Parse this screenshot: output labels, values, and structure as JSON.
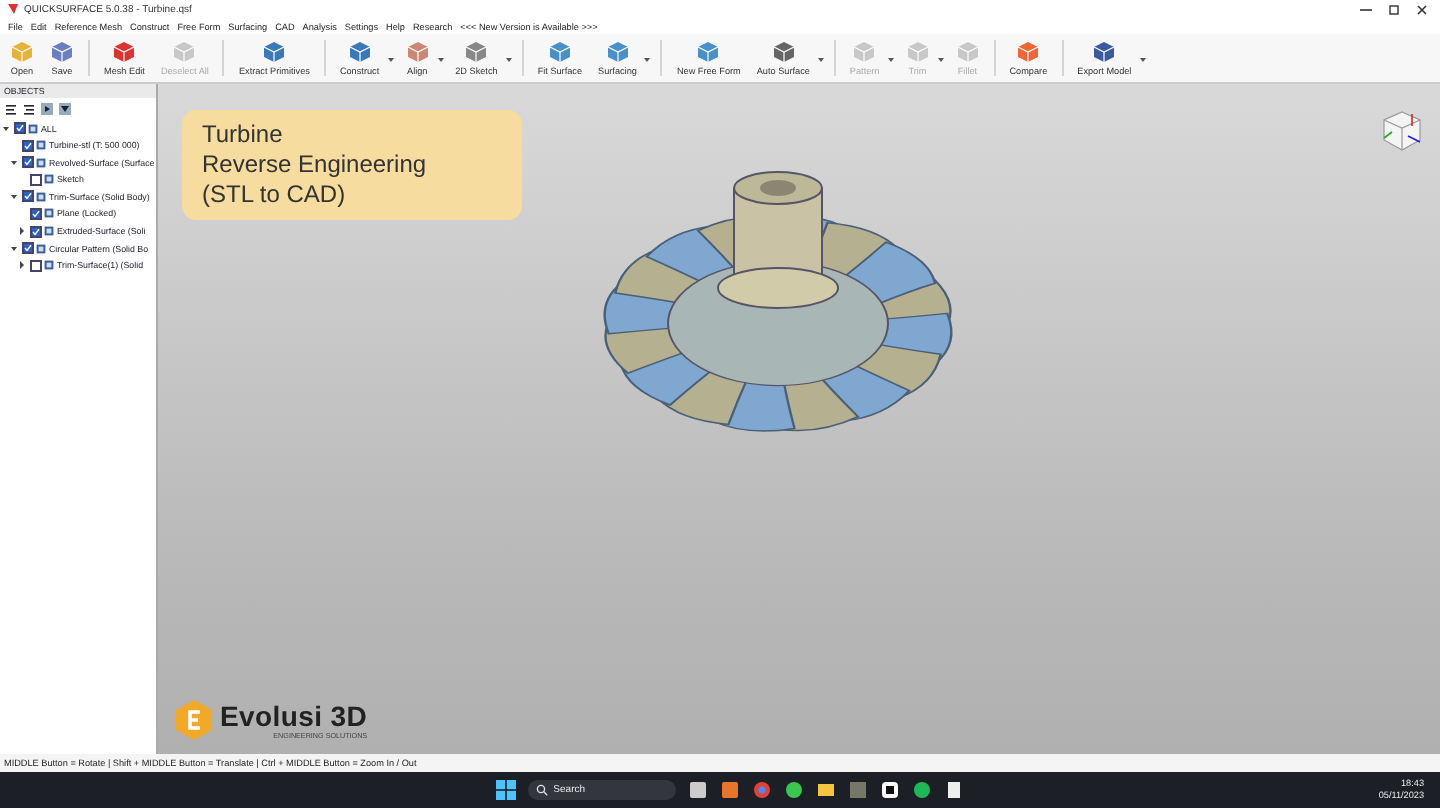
{
  "window": {
    "title": "QUICKSURFACE 5.0.38 - Turbine.qsf"
  },
  "menu": [
    "File",
    "Edit",
    "Reference Mesh",
    "Construct",
    "Free Form",
    "Surfacing",
    "CAD",
    "Analysis",
    "Settings",
    "Help",
    "Research"
  ],
  "version_notice": "<<< New Version is Available >>>",
  "toolbar": [
    {
      "label": "Open",
      "disabled": false,
      "dropdown": false
    },
    {
      "label": "Save",
      "disabled": false,
      "dropdown": false
    },
    {
      "label": "Mesh Edit",
      "disabled": false,
      "dropdown": false
    },
    {
      "label": "Deselect All",
      "disabled": true,
      "dropdown": false
    },
    {
      "label": "Extract Primitives",
      "disabled": false,
      "dropdown": false
    },
    {
      "label": "Construct",
      "disabled": false,
      "dropdown": true
    },
    {
      "label": "Align",
      "disabled": false,
      "dropdown": true
    },
    {
      "label": "2D Sketch",
      "disabled": false,
      "dropdown": true
    },
    {
      "label": "Fit Surface",
      "disabled": false,
      "dropdown": false
    },
    {
      "label": "Surfacing",
      "disabled": false,
      "dropdown": true
    },
    {
      "label": "New Free Form",
      "disabled": false,
      "dropdown": false
    },
    {
      "label": "Auto Surface",
      "disabled": false,
      "dropdown": true
    },
    {
      "label": "Pattern",
      "disabled": true,
      "dropdown": true
    },
    {
      "label": "Trim",
      "disabled": true,
      "dropdown": true
    },
    {
      "label": "Fillet",
      "disabled": true,
      "dropdown": false
    },
    {
      "label": "Compare",
      "disabled": false,
      "dropdown": false
    },
    {
      "label": "Export Model",
      "disabled": false,
      "dropdown": true
    }
  ],
  "objects": {
    "title": "OBJECTS",
    "tree": [
      {
        "label": "ALL",
        "checked": true,
        "expanded": true,
        "children": [
          {
            "label": "Turbine-stl (T: 500 000)",
            "checked": true
          },
          {
            "label": "Revolved-Surface (Surface",
            "checked": true,
            "expanded": true,
            "children": [
              {
                "label": "Sketch",
                "checked": false
              }
            ]
          },
          {
            "label": "Trim-Surface (Solid Body)",
            "checked": true,
            "expanded": true,
            "children": [
              {
                "label": "Plane (Locked)",
                "checked": true
              },
              {
                "label": "Extruded-Surface (Soli",
                "checked": true,
                "expanded": false
              }
            ]
          },
          {
            "label": "Circular Pattern (Solid Bo",
            "checked": true,
            "expanded": true,
            "children": [
              {
                "label": "Trim-Surface(1) (Solid",
                "checked": false,
                "expanded": false
              }
            ]
          }
        ]
      }
    ]
  },
  "overlay": {
    "lines": [
      "Turbine",
      "Reverse Engineering",
      "(STL to CAD)"
    ]
  },
  "logo": {
    "name": "Evolusi 3D",
    "tagline": "ENGINEERING SOLUTIONS"
  },
  "status_bar": "MIDDLE Button = Rotate | Shift + MIDDLE Button = Translate | Ctrl + MIDDLE Button = Zoom In / Out",
  "taskbar": {
    "search": "Search",
    "time": "18:43",
    "date": "05/11/2023"
  }
}
